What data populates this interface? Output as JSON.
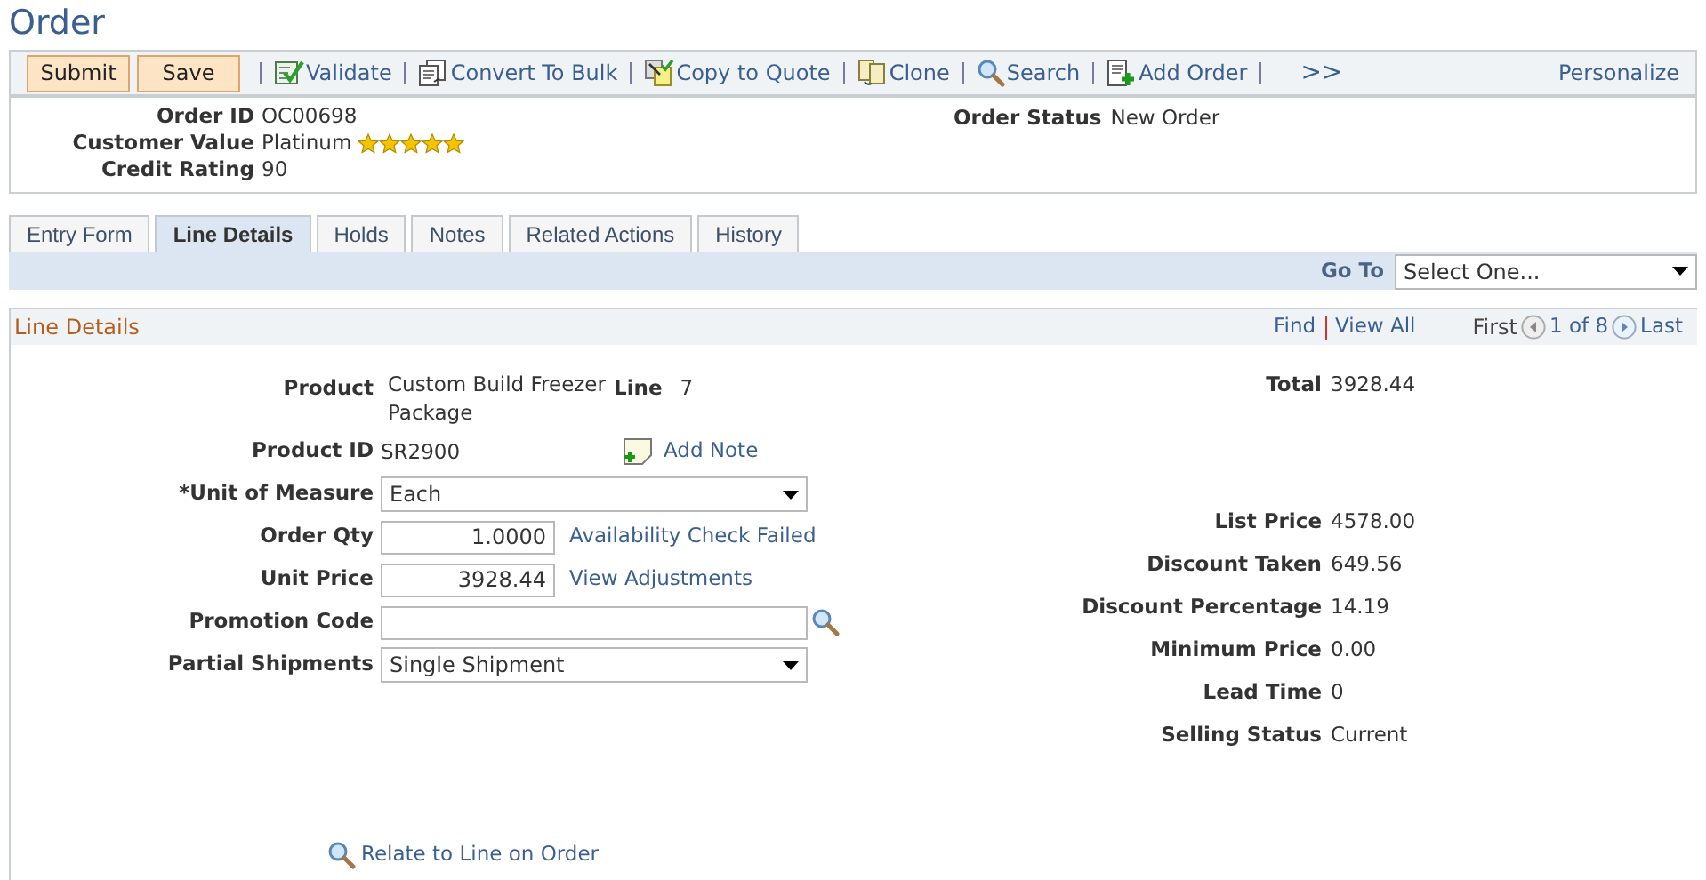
{
  "title": "Order",
  "toolbar": {
    "buttons": [
      "Submit",
      "Save"
    ],
    "actions": [
      {
        "label": "Validate",
        "kind": "validate"
      },
      {
        "label": "Convert To Bulk",
        "kind": "convert"
      },
      {
        "label": "Copy to Quote",
        "kind": "copy"
      },
      {
        "label": "Clone",
        "kind": "clone"
      },
      {
        "label": "Search",
        "kind": "search"
      },
      {
        "label": "Add Order",
        "kind": "add"
      }
    ],
    "more": ">>",
    "personalize": "Personalize"
  },
  "header": {
    "fields": [
      {
        "label": "Order ID",
        "value": "OC00698"
      },
      {
        "label": "Customer Value",
        "value": "Platinum",
        "stars": 5
      },
      {
        "label": "Credit Rating",
        "value": "90"
      }
    ],
    "status": {
      "label": "Order Status",
      "value": "New Order"
    }
  },
  "tabs": [
    {
      "label": "Entry Form",
      "selected": false
    },
    {
      "label": "Line Details",
      "selected": true
    },
    {
      "label": "Holds",
      "selected": false
    },
    {
      "label": "Notes",
      "selected": false
    },
    {
      "label": "Related Actions",
      "selected": false
    },
    {
      "label": "History",
      "selected": false
    }
  ],
  "goto": {
    "label": "Go To",
    "value": "Select One..."
  },
  "section": {
    "title": "Line Details",
    "nav": {
      "find": "Find",
      "view_all": "View All",
      "first": "First",
      "position": "1 of 8",
      "last": "Last"
    },
    "product": {
      "label": "Product",
      "value": "Custom Build Freezer Package"
    },
    "line": {
      "label": "Line",
      "value": "7"
    },
    "fields": [
      {
        "label": "Product ID",
        "kind": "text",
        "value": "SR2900",
        "link": "Add Note"
      },
      {
        "label": "*Unit of Measure",
        "kind": "dropdown",
        "value": "Each"
      },
      {
        "label": "Order Qty",
        "kind": "input",
        "value": "1.0000",
        "link": "Availability Check Failed"
      },
      {
        "label": "Unit Price",
        "kind": "input",
        "value": "3928.44",
        "link": "View Adjustments"
      },
      {
        "label": "Promotion Code",
        "kind": "lookup"
      },
      {
        "label": "Partial Shipments",
        "kind": "dropdown",
        "value": "Single Shipment"
      }
    ],
    "total": {
      "label": "Total",
      "value": "3928.44"
    },
    "pricing": [
      {
        "label": "List Price",
        "value": "4578.00"
      },
      {
        "label": "Discount Taken",
        "value": "649.56"
      },
      {
        "label": "Discount Percentage",
        "value": "14.19"
      },
      {
        "label": "Minimum Price",
        "value": "0.00"
      },
      {
        "label": "Lead Time",
        "value": "0"
      },
      {
        "label": "Selling Status",
        "value": "Current"
      }
    ],
    "relate_link": "Relate to Line on Order"
  }
}
